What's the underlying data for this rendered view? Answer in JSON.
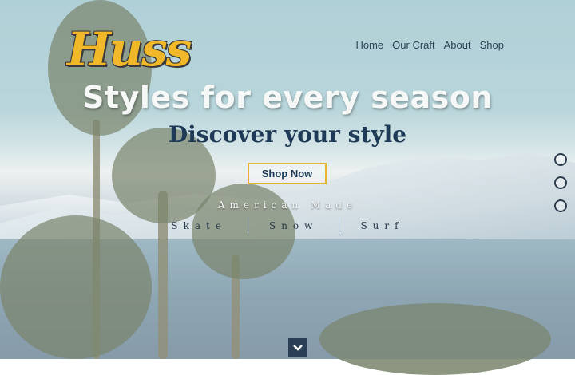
{
  "brand": {
    "logo_text": "Huss",
    "logo_color": "#f1b92a"
  },
  "nav": {
    "items": [
      "Home",
      "Our Craft",
      "About",
      "Shop"
    ]
  },
  "hero": {
    "headline": "Styles for every season",
    "subheadline": "Discover your style",
    "cta_label": "Shop Now",
    "tagline": "American Made",
    "categories": [
      "Skate",
      "Snow",
      "Surf"
    ]
  },
  "slider": {
    "dot_count": 3
  },
  "icons": {
    "scroll_down": "chevron-down-icon"
  },
  "colors": {
    "accent": "#e6b52f",
    "navy": "#1f3a57"
  }
}
